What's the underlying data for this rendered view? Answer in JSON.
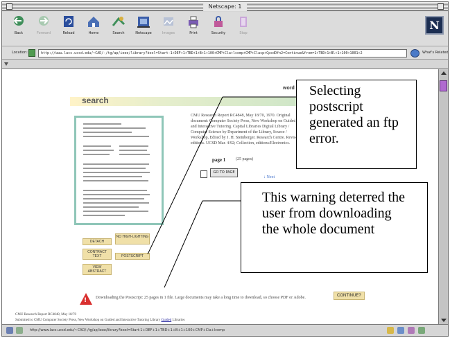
{
  "window": {
    "title": "Netscape: 1"
  },
  "toolbar": {
    "buttons": [
      {
        "label": "Back",
        "icon": "back-arrow-icon",
        "enabled": true
      },
      {
        "label": "Forward",
        "icon": "forward-arrow-icon",
        "enabled": false
      },
      {
        "label": "Reload",
        "icon": "reload-icon",
        "enabled": true
      },
      {
        "label": "Home",
        "icon": "home-icon",
        "enabled": true
      },
      {
        "label": "Search",
        "icon": "search-icon",
        "enabled": true
      },
      {
        "label": "Netscape",
        "icon": "netscape-icon",
        "enabled": true
      },
      {
        "label": "Images",
        "icon": "images-icon",
        "enabled": false
      },
      {
        "label": "Print",
        "icon": "print-icon",
        "enabled": true
      },
      {
        "label": "Security",
        "icon": "security-lock-icon",
        "enabled": true
      },
      {
        "label": "Stop",
        "icon": "stop-icon",
        "enabled": false
      }
    ],
    "brand": "N"
  },
  "location": {
    "label": "Location:",
    "url": "http://www.lacs.ucsd.edu/~CAD/-/tg/ap/ieee/library?bool=Start-1+DEF+1+TBD+1+B+1+100+CMP+Cla+lcomp+CMP+Clasp+CpcdDfn2=Continue&from=1+TBD+1+Bl+1+100+1001+2",
    "related_label": "What's Related"
  },
  "page": {
    "search_heading": "search",
    "top_word": "word",
    "abstract": "CMU Research Report RC4848, May 18/70, 1970. Original document: Computer Society Press, New Workshop on Guided and Interactive Tutoring. Capital Libraries Digital Library / Computer Science by Department of the Library, Source / Workshop, Edited by J. H. Steinberger. Research Centre. Revised editions. UCSD Mar. 4/92; Collection, editions/Electronics.",
    "page_label": "page 1",
    "page_of": "(25 pages)",
    "go_button": "GO TO PAGE",
    "next_label": "Next",
    "tags": {
      "detach": "DETACH",
      "no_highlighting": "NO HIGH-LIGHTING",
      "contract_text": "CONTRACT TEXT",
      "postscript": "POSTSCRIPT",
      "view_abstract": "VIEW ABSTRACT"
    },
    "warning": "Downloading the Postscript: 25 pages in 1 file. Large documents may take a long time to download, so choose PDF or Adobe.",
    "continue": "CONTINUE?",
    "footer_line1": "CMU Research Report RC4848, May 18/70",
    "footer_line2_prefix": "Submitted to CMU Computer Society Press, New Workshop on Guided and Interactive Tutoring Library",
    "footer_line2_link": "Guided",
    "footer_line2_suffix": "Libraries"
  },
  "status": {
    "text": "http://www.lacs.ucsd.edu/~CAD/-/tg/ap/ieee/library?bool=Start-1+DEF+1+TBD+1+B+1+100+CMP+Cla+lcomp"
  },
  "annotations": {
    "callout_top": "Selecting postscript generated an ftp error.",
    "callout_bottom": "This warning deterred the user from downloading the whole document"
  },
  "colors": {
    "accent_strip": "#cfe6c8",
    "tag_fill": "#f0e0a8",
    "warning_red": "#d9302f",
    "scroll_thumb": "#b06ad0"
  }
}
